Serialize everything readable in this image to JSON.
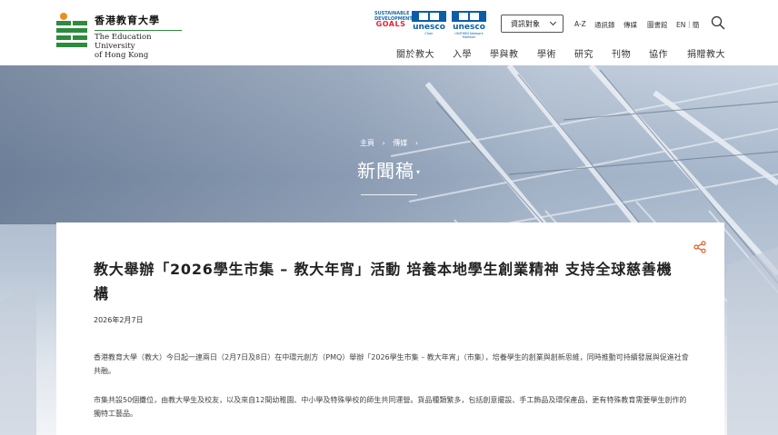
{
  "header": {
    "logo": {
      "zh": "香港教育大學",
      "en_line1": "The Education University",
      "en_line2": "of Hong Kong"
    },
    "partners": {
      "sdg_line1": "SUSTAINABLE",
      "sdg_line2": "DEVELOPMENT",
      "sdg_goals": "GOALS",
      "unesco1": "unesco",
      "unesco1_sub": "Chair",
      "unesco2": "unesco",
      "unesco2_sub": "UNITWIN Network Member"
    },
    "info_select": "資訊對象",
    "utility": {
      "az": "A-Z",
      "directory": "通訊錄",
      "media": "傳媒",
      "library": "圖書館",
      "lang": "EN｜簡"
    },
    "nav": [
      "關於教大",
      "入學",
      "學與教",
      "學術",
      "研究",
      "刊物",
      "協作",
      "捐贈教大"
    ]
  },
  "hero": {
    "breadcrumb": [
      "主頁",
      "傳媒"
    ],
    "breadcrumb_sep": "›",
    "title": "新聞稿",
    "title_caret": "▾"
  },
  "article": {
    "headline": "教大舉辦「2026學生市集 – 教大年宵」活動 培養本地學生創業精神 支持全球慈善機構",
    "date": "2026年2月7日",
    "paragraph1": "香港教育大學（教大）今日起一連兩日（2月7日及8日）在中環元創方（PMQ）舉辦「2026學生市集 – 教大年宵」（市集），培養學生的創業與創新思維，同時推動可持續發展與促進社會共融。",
    "paragraph2": "市集共設50個攤位，由教大學生及校友，以及來自12間幼稚園、中小學及特殊學校的師生共同運營。貨品種類繁多，包括創意擺設、手工飾品及環保產品，更有特殊教育需要學生創作的獨特工藝品。"
  },
  "colors": {
    "brand_green": "#2e8b3e",
    "brand_orange": "#f08c1e",
    "unesco_blue": "#0a5ea8",
    "share_orange": "#e05a28"
  },
  "icons": {
    "search": "search-icon",
    "share": "share-icon",
    "chevron": "chevron-down-icon"
  }
}
